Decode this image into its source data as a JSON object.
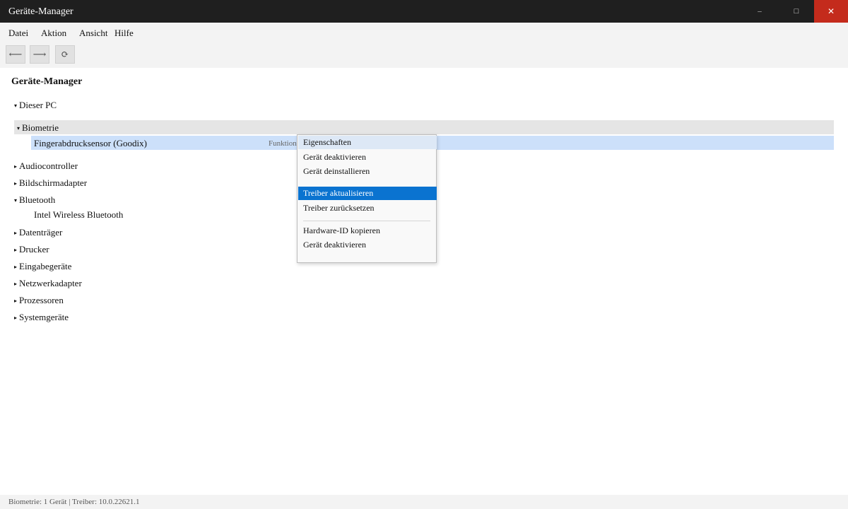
{
  "window": {
    "title": "Geräte-Manager",
    "minimize": "–",
    "maximize": "□",
    "close": "✕"
  },
  "menu": [
    "Datei",
    "Aktion",
    "Ansicht",
    "Hilfe"
  ],
  "toolbar": {
    "back": "⟵",
    "forward": "⟶",
    "refresh": "⟳"
  },
  "main": {
    "heading": "Geräte-Manager",
    "root": {
      "label": "Dieser PC",
      "expanded": true
    },
    "biometrie": {
      "label": "Biometrie",
      "expanded": true,
      "device": {
        "name": "Fingerabdrucksensor (Goodix)",
        "status": "Funktion"
      }
    },
    "categories": [
      {
        "label": "Audiocontroller",
        "expanded": false
      },
      {
        "label": "Bildschirmadapter",
        "expanded": false
      },
      {
        "label": "Bluetooth",
        "expanded": true,
        "children": [
          "Intel Wireless Bluetooth"
        ]
      },
      {
        "label": "Datenträger",
        "expanded": false
      },
      {
        "label": "Drucker",
        "expanded": false
      },
      {
        "label": "Eingabegeräte",
        "expanded": false
      },
      {
        "label": "Netzwerkadapter",
        "expanded": false
      },
      {
        "label": "Prozessoren",
        "expanded": false
      },
      {
        "label": "Systemgeräte",
        "expanded": false
      }
    ],
    "caret_expanded": "▾",
    "caret_collapsed": "▸"
  },
  "context_menu": {
    "items": [
      "Eigenschaften",
      "Gerät deaktivieren",
      "Gerät deinstallieren",
      "Treiber aktualisieren",
      "Treiber zurücksetzen",
      "Hardware-ID kopieren",
      "Gerät deaktivieren"
    ],
    "hover_index": 0,
    "active_index": 3
  },
  "statusbar": {
    "text": "Biometrie: 1 Gerät | Treiber: 10.0.22621.1"
  },
  "colors": {
    "titlebar": "#1f1f1f",
    "close": "#c42b1c",
    "selection": "#cce0fa",
    "menu_highlight": "#0a73d0"
  }
}
